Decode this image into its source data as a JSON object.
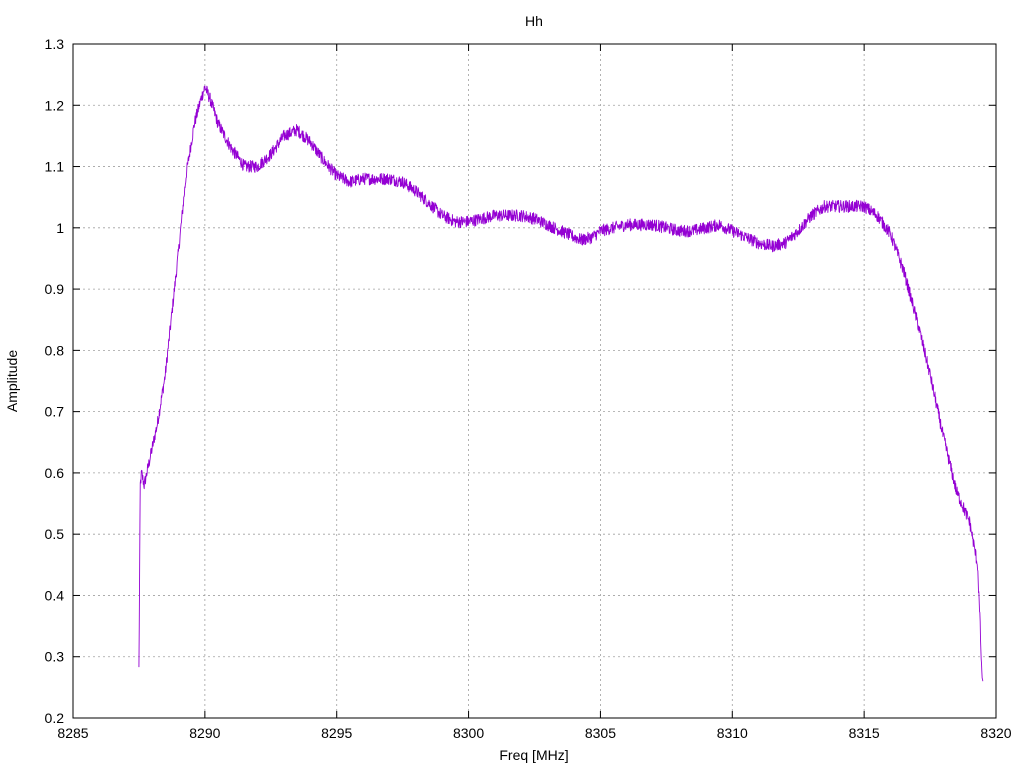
{
  "chart_data": {
    "type": "line",
    "title": "Hh",
    "xlabel": "Freq [MHz]",
    "ylabel": "Amplitude",
    "xlim": [
      8285,
      8320
    ],
    "ylim": [
      0.2,
      1.3
    ],
    "xticks": [
      8285,
      8290,
      8295,
      8300,
      8305,
      8310,
      8315,
      8320
    ],
    "xtick_labels": [
      "8285",
      "8290",
      "8295",
      "8300",
      "8305",
      "8310",
      "8315",
      "8320"
    ],
    "yticks": [
      0.2,
      0.3,
      0.4,
      0.5,
      0.6,
      0.7,
      0.8,
      0.9,
      1.0,
      1.1,
      1.2,
      1.3
    ],
    "ytick_labels": [
      "0.2",
      "0.3",
      "0.4",
      "0.5",
      "0.6",
      "0.7",
      "0.8",
      "0.9",
      "1",
      "1.1",
      "1.2",
      "1.3"
    ],
    "grid": true,
    "series": [
      {
        "color": "#9400d3",
        "noise_amplitude": 0.01,
        "x": [
          8287.5,
          8287.55,
          8287.6,
          8287.7,
          8287.8,
          8288.0,
          8288.2,
          8288.5,
          8288.8,
          8289.0,
          8289.3,
          8289.6,
          8289.85,
          8290.0,
          8290.2,
          8290.5,
          8291.0,
          8291.5,
          8292.0,
          8292.5,
          8293.0,
          8293.5,
          8294.0,
          8294.5,
          8295.0,
          8295.5,
          8296.0,
          8296.5,
          8297.0,
          8297.5,
          8298.0,
          8298.5,
          8299.0,
          8299.5,
          8300.0,
          8300.5,
          8301.0,
          8301.5,
          8302.0,
          8302.5,
          8303.0,
          8303.5,
          8304.0,
          8304.3,
          8304.7,
          8305.0,
          8305.5,
          8306.0,
          8306.5,
          8307.0,
          8307.5,
          8308.0,
          8308.5,
          8309.0,
          8309.5,
          8310.0,
          8310.5,
          8311.0,
          8311.5,
          8312.0,
          8312.5,
          8313.0,
          8313.5,
          8314.0,
          8314.5,
          8315.0,
          8315.5,
          8316.0,
          8316.5,
          8317.0,
          8317.5,
          8318.0,
          8318.5,
          8319.0,
          8319.3,
          8319.4,
          8319.45,
          8319.5
        ],
        "y": [
          0.28,
          0.58,
          0.6,
          0.58,
          0.6,
          0.64,
          0.68,
          0.76,
          0.88,
          0.96,
          1.09,
          1.17,
          1.21,
          1.23,
          1.21,
          1.17,
          1.13,
          1.1,
          1.1,
          1.12,
          1.15,
          1.16,
          1.14,
          1.11,
          1.085,
          1.075,
          1.08,
          1.08,
          1.08,
          1.075,
          1.06,
          1.04,
          1.02,
          1.01,
          1.01,
          1.015,
          1.02,
          1.02,
          1.02,
          1.015,
          1.005,
          0.995,
          0.985,
          0.98,
          0.985,
          0.995,
          1.0,
          1.005,
          1.005,
          1.005,
          1.0,
          0.995,
          0.995,
          1.0,
          1.005,
          0.995,
          0.985,
          0.975,
          0.97,
          0.975,
          0.995,
          1.02,
          1.035,
          1.035,
          1.035,
          1.035,
          1.02,
          0.99,
          0.93,
          0.85,
          0.76,
          0.66,
          0.57,
          0.52,
          0.45,
          0.35,
          0.28,
          0.26
        ]
      }
    ]
  }
}
